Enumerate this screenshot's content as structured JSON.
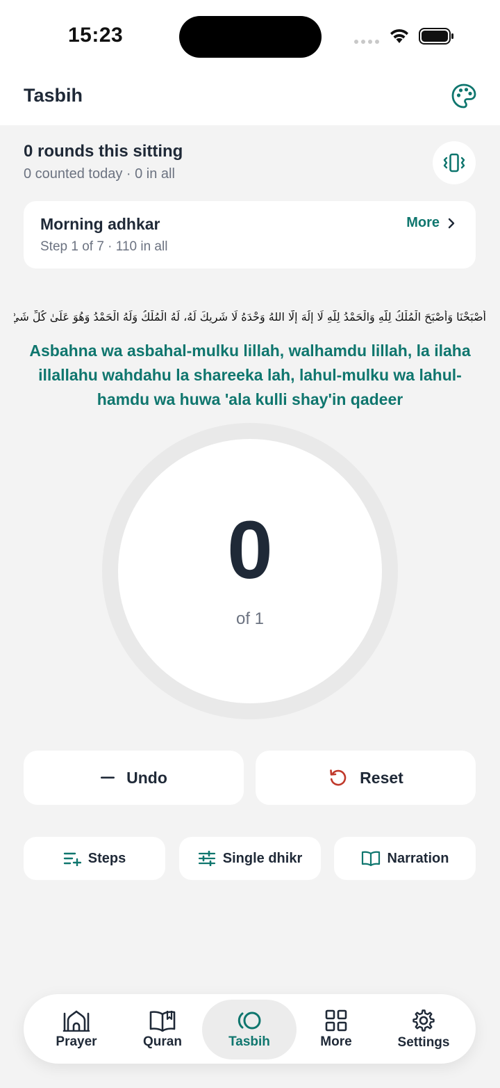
{
  "status_bar": {
    "time": "15:23"
  },
  "header": {
    "title": "Tasbih",
    "theme_icon": "palette-icon"
  },
  "summary": {
    "rounds": "0 rounds this sitting",
    "totals": "0 counted today · 0 in all",
    "haptic_icon": "vibrate-icon"
  },
  "routine": {
    "name": "Morning adhkar",
    "step": "Step 1 of 7 · 110 in all",
    "more_label": "More"
  },
  "dhikr": {
    "arabic": "أَصْبَحْنَا وَأَصْبَحَ الْمُلْكُ لِلَّهِ وَالْحَمْدُ لِلَّهِ لَا إِلَٰهَ إِلَّا اللهُ وَحْدَهُ لَا شَرِيكَ لَهُ، لَهُ الْمُلْكُ وَلَهُ الْحَمْدُ وَهُوَ عَلَىٰ كُلِّ شَيْءٍ قَدِيرٌ",
    "transliteration": "Asbahna wa asbahal-mulku lillah, walhamdu lillah, la ilaha illallahu wahdahu la shareeka lah, lahul-mulku wa lahul-hamdu wa huwa 'ala kulli shay'in qadeer"
  },
  "counter": {
    "value": "0",
    "target": "of 1",
    "progress": 0
  },
  "actions": {
    "undo": "Undo",
    "reset": "Reset"
  },
  "tools": {
    "steps": "Steps",
    "single": "Single dhikr",
    "narration": "Narration"
  },
  "tabs": [
    {
      "label": "Prayer",
      "icon": "mosque-icon"
    },
    {
      "label": "Quran",
      "icon": "book-icon"
    },
    {
      "label": "Tasbih",
      "icon": "tasbih-icon",
      "active": true
    },
    {
      "label": "More",
      "icon": "grid-icon"
    },
    {
      "label": "Settings",
      "icon": "gear-icon"
    }
  ],
  "colors": {
    "accent": "#0f766e",
    "reset": "#c0392b",
    "background": "#f3f3f3"
  }
}
